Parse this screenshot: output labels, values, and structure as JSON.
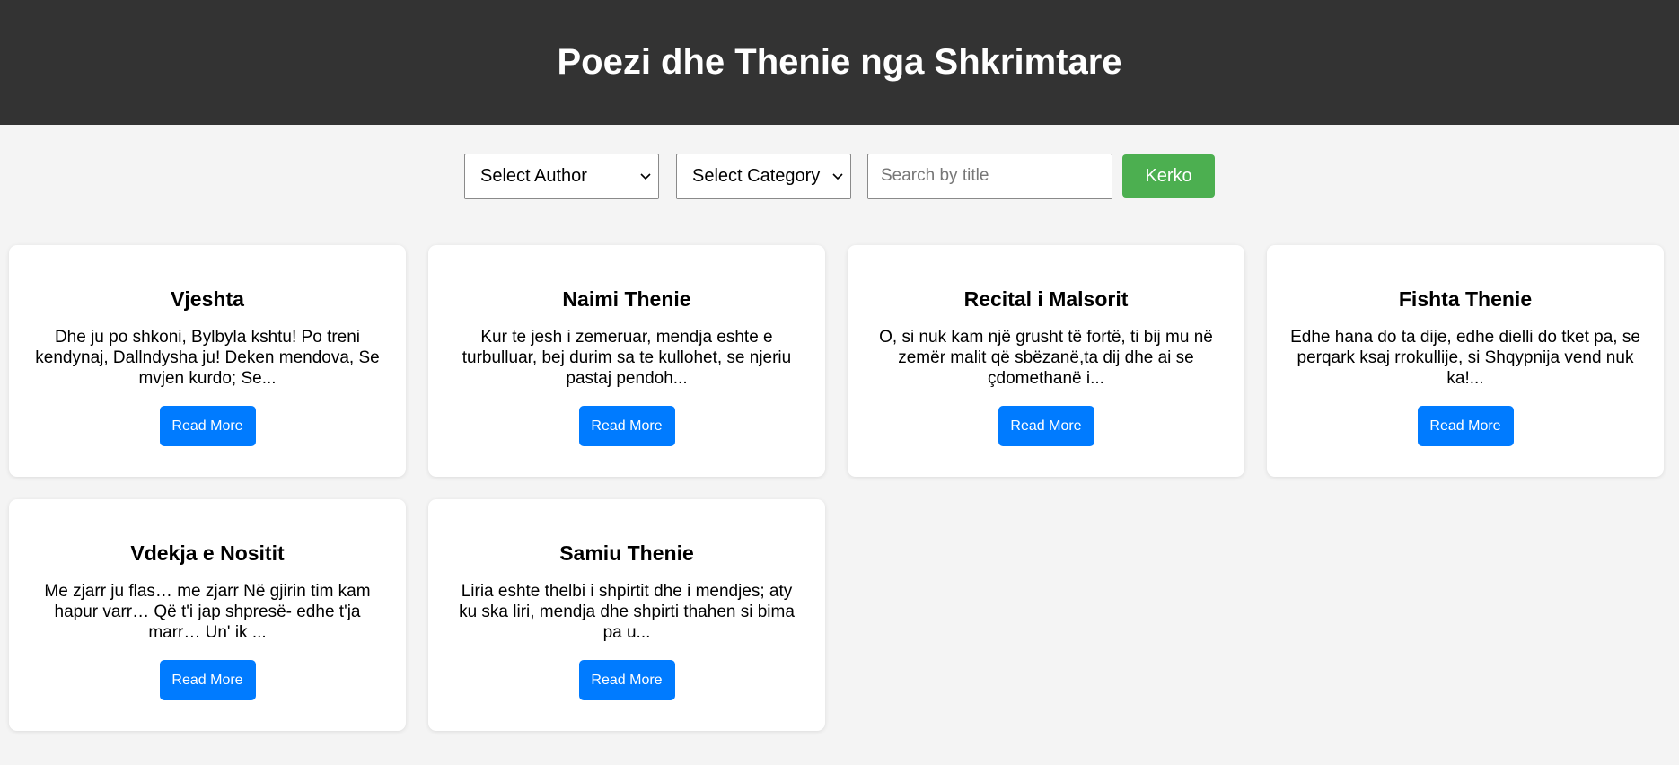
{
  "header": {
    "title": "Poezi dhe Thenie nga Shkrimtare"
  },
  "filters": {
    "author_select": "Select Author",
    "category_select": "Select Category",
    "search_placeholder": "Search by title",
    "search_button": "Kerko"
  },
  "cards": [
    {
      "title": "Vjeshta",
      "excerpt": "Dhe ju po shkoni, Bylbyla kshtu! Po treni kendynaj, Dallndysha ju! Deken mendova, Se mvjen kurdo; Se...",
      "button": "Read More"
    },
    {
      "title": "Naimi Thenie",
      "excerpt": "Kur te jesh i zemeruar, mendja eshte e turbulluar, bej durim sa te kullohet, se njeriu pastaj pendoh...",
      "button": "Read More"
    },
    {
      "title": "Recital i Malsorit",
      "excerpt": "O, si nuk kam një grusht të fortë, ti bij mu në zemër malit që sbëzanë,ta dij dhe ai se çdomethanë i...",
      "button": "Read More"
    },
    {
      "title": "Fishta Thenie",
      "excerpt": "Edhe hana do ta dije, edhe dielli do tket pa, se perqark ksaj rrokullije, si Shqypnija vend nuk ka!...",
      "button": "Read More"
    },
    {
      "title": "Vdekja e Nositit",
      "excerpt": "Me zjarr ju flas… me zjarr Në gjirin tim kam hapur varr… Që t'i jap shpresë- edhe t'ja marr… Un' ik ...",
      "button": "Read More"
    },
    {
      "title": "Samiu Thenie",
      "excerpt": "Liria eshte thelbi i shpirtit dhe i mendjes; aty ku ska liri, mendja dhe shpirti thahen si bima pa u...",
      "button": "Read More"
    }
  ],
  "colors": {
    "header_bg": "#333333",
    "page_bg": "#f4f4f4",
    "search_button": "#4caf50",
    "read_more_button": "#007bff"
  },
  "icons": {
    "select_arrow": "chevron-down-icon"
  }
}
